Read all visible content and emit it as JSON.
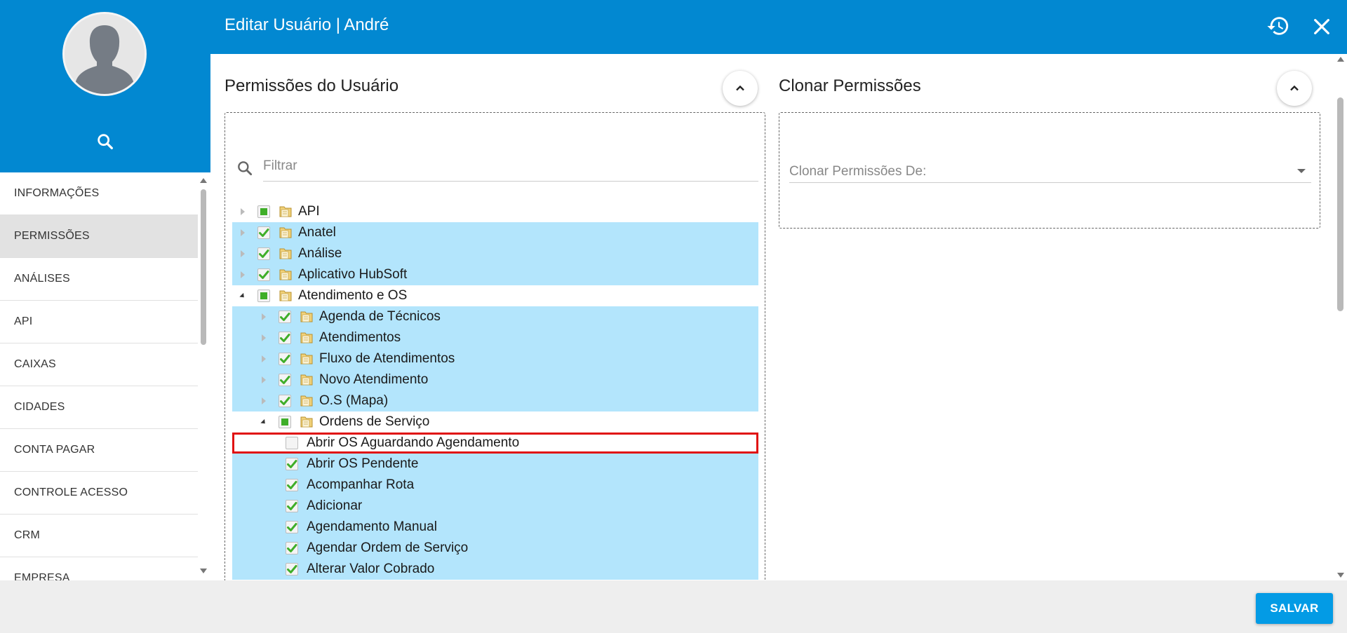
{
  "header": {
    "title": "Editar Usuário | André",
    "history_icon": "history-icon",
    "close_icon": "close-icon"
  },
  "sidebar": {
    "avatar_icon": "user-silhouette-icon",
    "search_icon": "search-icon",
    "items": [
      {
        "label": "INFORMAÇÕES",
        "active": false
      },
      {
        "label": "PERMISSÕES",
        "active": true
      },
      {
        "label": "ANÁLISES",
        "active": false
      },
      {
        "label": "API",
        "active": false
      },
      {
        "label": "CAIXAS",
        "active": false
      },
      {
        "label": "CIDADES",
        "active": false
      },
      {
        "label": "CONTA PAGAR",
        "active": false
      },
      {
        "label": "CONTROLE ACESSO",
        "active": false
      },
      {
        "label": "CRM",
        "active": false
      },
      {
        "label": "EMPRESA",
        "active": false
      }
    ]
  },
  "permissions": {
    "title": "Permissões do Usuário",
    "filter_placeholder": "Filtrar",
    "tree": [
      {
        "label": "API",
        "level": 0,
        "expand": "collapsed",
        "check": "partial",
        "folder": true,
        "selected": false
      },
      {
        "label": "Anatel",
        "level": 0,
        "expand": "collapsed",
        "check": "checked",
        "folder": true,
        "selected": true
      },
      {
        "label": "Análise",
        "level": 0,
        "expand": "collapsed",
        "check": "checked",
        "folder": true,
        "selected": true
      },
      {
        "label": "Aplicativo HubSoft",
        "level": 0,
        "expand": "collapsed",
        "check": "checked",
        "folder": true,
        "selected": true
      },
      {
        "label": "Atendimento e OS",
        "level": 0,
        "expand": "expanded",
        "check": "partial",
        "folder": true,
        "selected": false
      },
      {
        "label": "Agenda de Técnicos",
        "level": 1,
        "expand": "collapsed",
        "check": "checked",
        "folder": true,
        "selected": true
      },
      {
        "label": "Atendimentos",
        "level": 1,
        "expand": "collapsed",
        "check": "checked",
        "folder": true,
        "selected": true
      },
      {
        "label": "Fluxo de Atendimentos",
        "level": 1,
        "expand": "collapsed",
        "check": "checked",
        "folder": true,
        "selected": true
      },
      {
        "label": "Novo Atendimento",
        "level": 1,
        "expand": "collapsed",
        "check": "checked",
        "folder": true,
        "selected": true
      },
      {
        "label": "O.S (Mapa)",
        "level": 1,
        "expand": "collapsed",
        "check": "checked",
        "folder": true,
        "selected": true
      },
      {
        "label": "Ordens de Serviço",
        "level": 1,
        "expand": "expanded",
        "check": "partial",
        "folder": true,
        "selected": false
      },
      {
        "label": "Abrir OS Aguardando Agendamento",
        "level": 2,
        "expand": "none",
        "check": "unchecked",
        "folder": false,
        "selected": false,
        "highlighted": true
      },
      {
        "label": "Abrir OS Pendente",
        "level": 2,
        "expand": "none",
        "check": "checked",
        "folder": false,
        "selected": true
      },
      {
        "label": "Acompanhar Rota",
        "level": 2,
        "expand": "none",
        "check": "checked",
        "folder": false,
        "selected": true
      },
      {
        "label": "Adicionar",
        "level": 2,
        "expand": "none",
        "check": "checked",
        "folder": false,
        "selected": true
      },
      {
        "label": "Agendamento Manual",
        "level": 2,
        "expand": "none",
        "check": "checked",
        "folder": false,
        "selected": true
      },
      {
        "label": "Agendar Ordem de Serviço",
        "level": 2,
        "expand": "none",
        "check": "checked",
        "folder": false,
        "selected": true
      },
      {
        "label": "Alterar Valor Cobrado",
        "level": 2,
        "expand": "none",
        "check": "checked",
        "folder": false,
        "selected": true
      }
    ]
  },
  "clone": {
    "title": "Clonar Permissões",
    "field_label": "Clonar Permissões De:"
  },
  "footer": {
    "save_label": "SALVAR"
  },
  "colors": {
    "primary": "#0288d1",
    "selected_row": "#b3e5fc",
    "highlight_border": "#e01010",
    "check_green": "#3fae29",
    "save_button": "#039be5"
  }
}
